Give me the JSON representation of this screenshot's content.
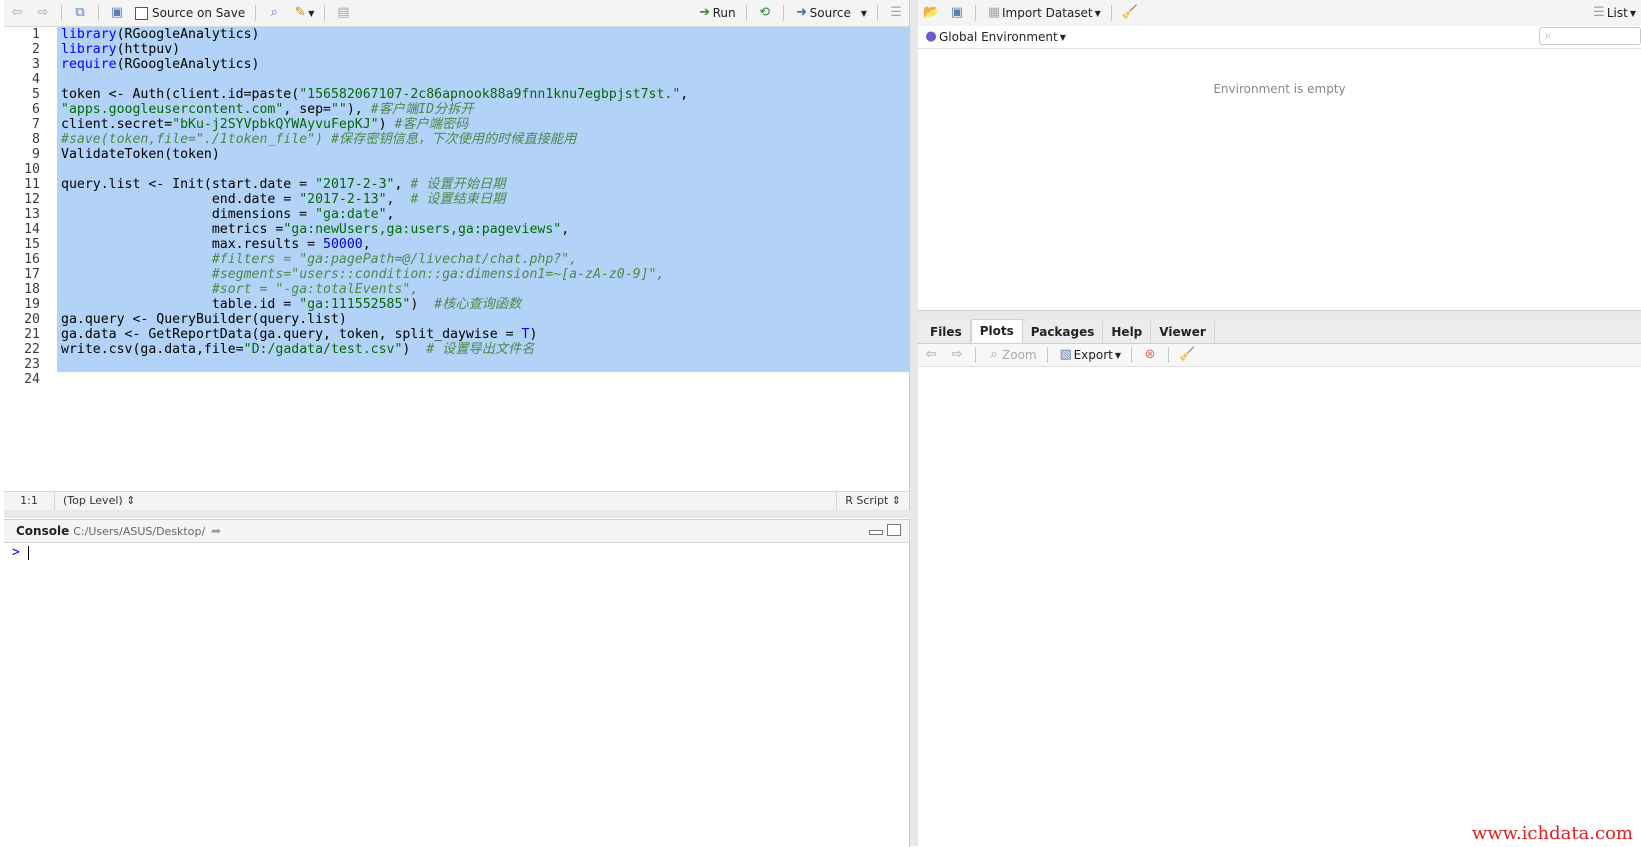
{
  "editor": {
    "toolbar": {
      "source_on_save_label": "Source on Save",
      "run_label": "Run",
      "source_label": "Source"
    },
    "code_lines": [
      {
        "n": "1",
        "html_parts": [
          [
            "kw",
            "library"
          ],
          [
            "",
            "(RGoogleAnalytics)"
          ]
        ]
      },
      {
        "n": "2",
        "html_parts": [
          [
            "kw",
            "library"
          ],
          [
            "",
            "(httpuv)"
          ]
        ]
      },
      {
        "n": "3",
        "html_parts": [
          [
            "kw",
            "require"
          ],
          [
            "",
            "(RGoogleAnalytics)"
          ]
        ]
      },
      {
        "n": "4",
        "html_parts": []
      },
      {
        "n": "5",
        "html_parts": [
          [
            "",
            "token <- Auth(client.id=paste("
          ],
          [
            "str",
            "\"156582067107-2c86apnook88a9fnn1knu7egbpjst7st.\""
          ],
          [
            "",
            ","
          ]
        ]
      },
      {
        "n": "6",
        "html_parts": [
          [
            "str",
            "\"apps.googleusercontent.com\""
          ],
          [
            "",
            ", sep="
          ],
          [
            "str",
            "\"\""
          ],
          [
            "",
            "), "
          ],
          [
            "cmt",
            "#客户端ID分拆开"
          ]
        ]
      },
      {
        "n": "7",
        "html_parts": [
          [
            "",
            "client.secret="
          ],
          [
            "str",
            "\"bKu-j2SYVpbkQYWAyvuFepKJ\""
          ],
          [
            "",
            ") "
          ],
          [
            "cmt",
            "#客户端密码"
          ]
        ]
      },
      {
        "n": "8",
        "html_parts": [
          [
            "cmt",
            "#save(token,file=\"./1token_file\") #保存密钥信息，下次使用的时候直接能用"
          ]
        ]
      },
      {
        "n": "9",
        "html_parts": [
          [
            "",
            "ValidateToken(token)"
          ]
        ]
      },
      {
        "n": "10",
        "html_parts": []
      },
      {
        "n": "11",
        "html_parts": [
          [
            "",
            "query.list <- Init(start.date = "
          ],
          [
            "str",
            "\"2017-2-3\""
          ],
          [
            "",
            ", "
          ],
          [
            "cmt",
            "# 设置开始日期"
          ]
        ]
      },
      {
        "n": "12",
        "html_parts": [
          [
            "",
            "                   end.date = "
          ],
          [
            "str",
            "\"2017-2-13\""
          ],
          [
            "",
            ",  "
          ],
          [
            "cmt",
            "# 设置结束日期"
          ]
        ]
      },
      {
        "n": "13",
        "html_parts": [
          [
            "",
            "                   dimensions = "
          ],
          [
            "str",
            "\"ga:date\""
          ],
          [
            "",
            ","
          ]
        ]
      },
      {
        "n": "14",
        "html_parts": [
          [
            "",
            "                   metrics ="
          ],
          [
            "str",
            "\"ga:newUsers,ga:users,ga:pageviews\""
          ],
          [
            "",
            ","
          ]
        ]
      },
      {
        "n": "15",
        "html_parts": [
          [
            "",
            "                   max.results = "
          ],
          [
            "num",
            "50000"
          ],
          [
            "",
            ","
          ]
        ]
      },
      {
        "n": "16",
        "html_parts": [
          [
            "",
            "                   "
          ],
          [
            "cmt",
            "#filters = \"ga:pagePath=@/livechat/chat.php?\","
          ]
        ]
      },
      {
        "n": "17",
        "html_parts": [
          [
            "",
            "                   "
          ],
          [
            "cmt",
            "#segments=\"users::condition::ga:dimension1=~[a-zA-z0-9]\","
          ]
        ]
      },
      {
        "n": "18",
        "html_parts": [
          [
            "",
            "                   "
          ],
          [
            "cmt",
            "#sort = \"-ga:totalEvents\","
          ]
        ]
      },
      {
        "n": "19",
        "html_parts": [
          [
            "",
            "                   table.id = "
          ],
          [
            "str",
            "\"ga:111552585\""
          ],
          [
            "",
            ")  "
          ],
          [
            "cmt",
            "#核心查询函数"
          ]
        ]
      },
      {
        "n": "20",
        "html_parts": [
          [
            "",
            "ga.query <- QueryBuilder(query.list)"
          ]
        ]
      },
      {
        "n": "21",
        "html_parts": [
          [
            "",
            "ga.data <- GetReportData(ga.query, token, split_daywise = "
          ],
          [
            "kw",
            "T"
          ],
          [
            "",
            ")"
          ]
        ]
      },
      {
        "n": "22",
        "html_parts": [
          [
            "",
            "write.csv(ga.data,file="
          ],
          [
            "str",
            "\"D:/gadata/test.csv\""
          ],
          [
            "",
            ")  "
          ],
          [
            "cmt",
            "# 设置导出文件名"
          ]
        ]
      },
      {
        "n": "23",
        "html_parts": []
      },
      {
        "n": "24",
        "html_parts": []
      }
    ],
    "status": {
      "position": "1:1",
      "scope": "(Top Level)",
      "filetype": "R Script"
    }
  },
  "console": {
    "title": "Console",
    "path": "C:/Users/ASUS/Desktop/",
    "prompt": ">"
  },
  "env": {
    "import_label": "Import Dataset",
    "list_label": "List",
    "scope_label": "Global Environment",
    "empty_message": "Environment is empty"
  },
  "files_pane": {
    "tabs": [
      "Files",
      "Plots",
      "Packages",
      "Help",
      "Viewer"
    ],
    "active_tab": "Plots",
    "zoom_label": "Zoom",
    "export_label": "Export"
  },
  "watermark": "www.ichdata.com",
  "colors": {
    "selection": "#b3d2f8",
    "string": "#036a07",
    "keyword": "#0000ff",
    "comment": "#4a8a4a",
    "watermark": "#e02020"
  }
}
